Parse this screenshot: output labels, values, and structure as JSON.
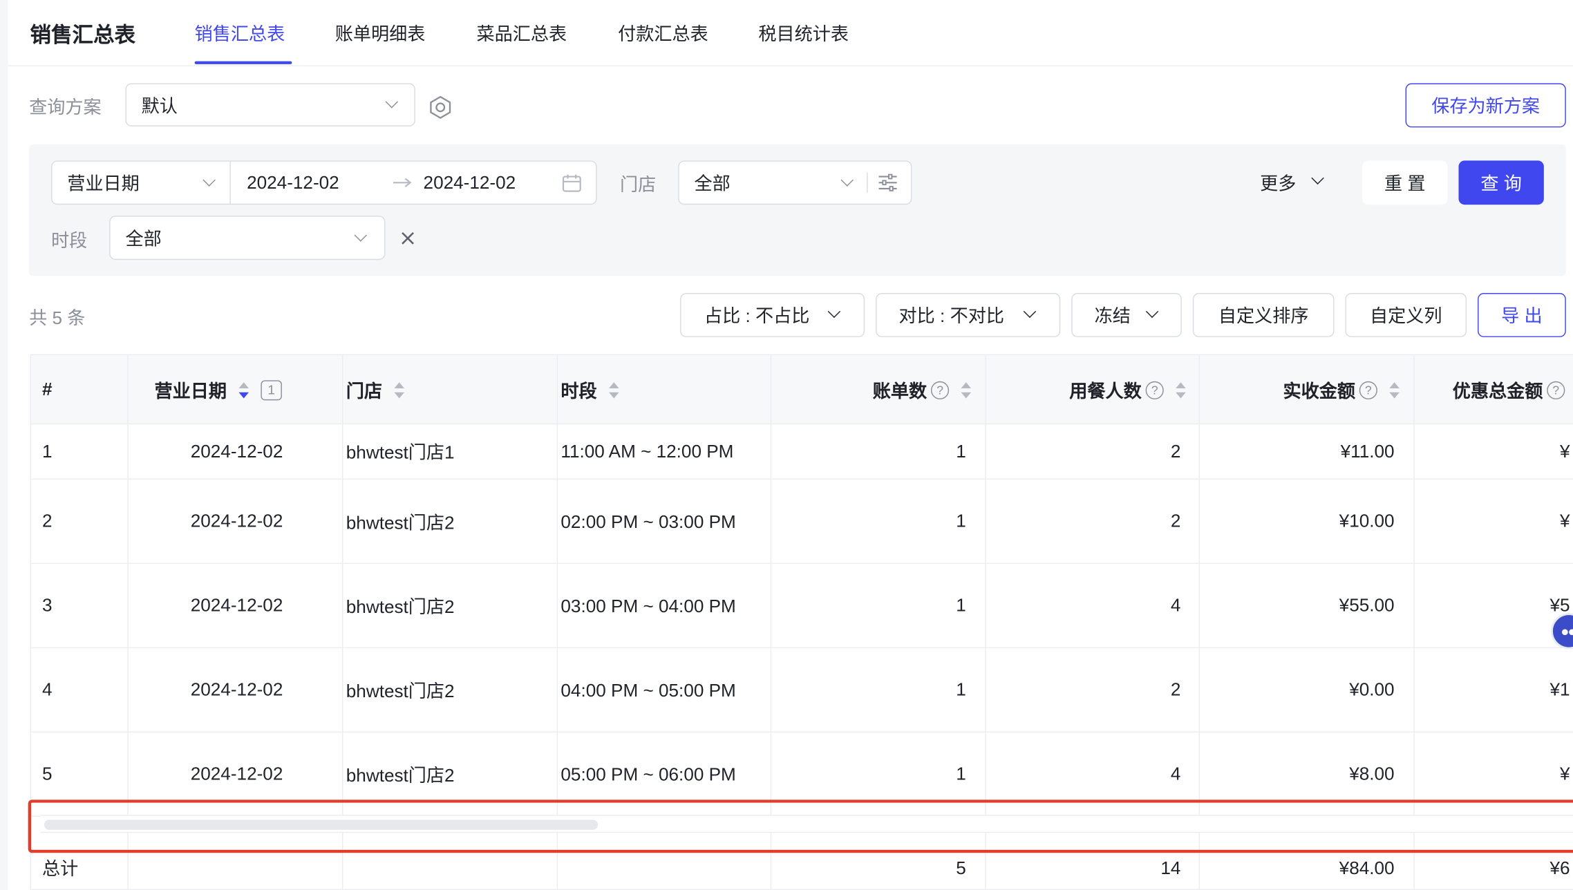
{
  "header": {
    "title": "销售汇总表",
    "tabs": [
      "销售汇总表",
      "账单明细表",
      "菜品汇总表",
      "付款汇总表",
      "税目统计表"
    ]
  },
  "scheme": {
    "label": "查询方案",
    "value": "默认",
    "save_button": "保存为新方案"
  },
  "filters": {
    "date_type": "营业日期",
    "date_start": "2024-12-02",
    "date_end": "2024-12-02",
    "store_label": "门店",
    "store_value": "全部",
    "more": "更多",
    "reset": "重 置",
    "query": "查 询",
    "period_label": "时段",
    "period_value": "全部"
  },
  "toolbar": {
    "count": "共 5 条",
    "ratio": "占比 : 不占比",
    "compare": "对比 : 不对比",
    "freeze": "冻结",
    "custom_sort": "自定义排序",
    "custom_cols": "自定义列",
    "export": "导 出"
  },
  "table": {
    "columns": [
      "#",
      "营业日期",
      "门店",
      "时段",
      "账单数",
      "用餐人数",
      "实收金额",
      "优惠总金额"
    ],
    "sort_badge": "1",
    "rows": [
      {
        "idx": "1",
        "date": "2024-12-02",
        "store": "bhwtest门店1",
        "period": "11:00 AM ~ 12:00 PM",
        "bills": "1",
        "guests": "2",
        "received": "¥11.00",
        "discount": "¥"
      },
      {
        "idx": "2",
        "date": "2024-12-02",
        "store": "bhwtest门店2",
        "period": "02:00 PM ~ 03:00 PM",
        "bills": "1",
        "guests": "2",
        "received": "¥10.00",
        "discount": "¥"
      },
      {
        "idx": "3",
        "date": "2024-12-02",
        "store": "bhwtest门店2",
        "period": "03:00 PM ~ 04:00 PM",
        "bills": "1",
        "guests": "4",
        "received": "¥55.00",
        "discount": "¥5"
      },
      {
        "idx": "4",
        "date": "2024-12-02",
        "store": "bhwtest门店2",
        "period": "04:00 PM ~ 05:00 PM",
        "bills": "1",
        "guests": "2",
        "received": "¥0.00",
        "discount": "¥1"
      },
      {
        "idx": "5",
        "date": "2024-12-02",
        "store": "bhwtest门店2",
        "period": "05:00 PM ~ 06:00 PM",
        "bills": "1",
        "guests": "4",
        "received": "¥8.00",
        "discount": "¥"
      }
    ],
    "total": {
      "label": "总计",
      "bills": "5",
      "guests": "14",
      "received": "¥84.00",
      "discount": "¥6"
    }
  },
  "colors": {
    "primary": "#4147ee",
    "highlight": "#e03d2c"
  }
}
